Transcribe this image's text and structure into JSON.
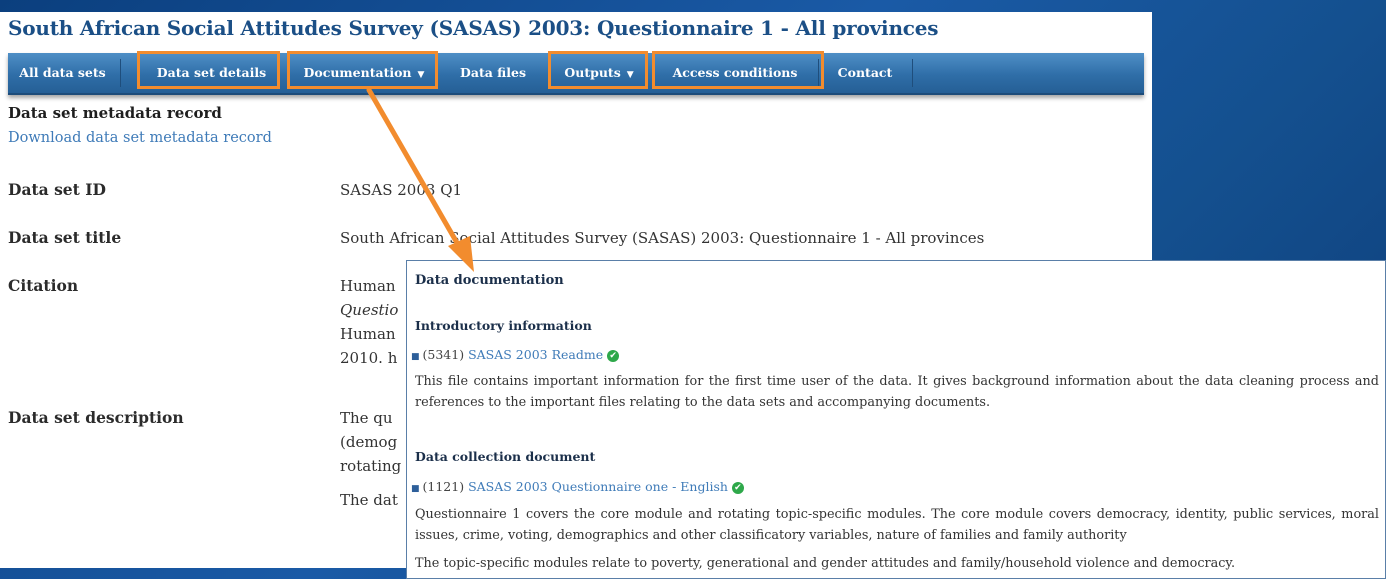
{
  "page_title": "South African Social Attitudes Survey (SASAS) 2003: Questionnaire 1 - All provinces",
  "nav": {
    "items": [
      {
        "label": "All data sets"
      },
      {
        "label": "Data set details"
      },
      {
        "label": "Documentation",
        "has_dropdown": true
      },
      {
        "label": "Data files"
      },
      {
        "label": "Outputs",
        "has_dropdown": true
      },
      {
        "label": "Access conditions"
      },
      {
        "label": "Contact"
      }
    ],
    "dropdown_caret": "▼",
    "highlighted": [
      "Data set details",
      "Documentation",
      "Outputs",
      "Access conditions"
    ]
  },
  "metadata": {
    "heading": "Data set metadata record",
    "download_link": "Download data set metadata record"
  },
  "fields": [
    {
      "label": "Data set ID",
      "value_lines": [
        "SASAS 2003 Q1"
      ]
    },
    {
      "label": "Data set title",
      "value_lines": [
        "South African Social Attitudes Survey (SASAS) 2003: Questionnaire 1 - All provinces"
      ]
    },
    {
      "label": "Citation",
      "value_lines": [
        "Human",
        "Questio",
        "Human",
        "2010. h"
      ]
    },
    {
      "label": "Data set description",
      "value_lines": [
        "The qu",
        "(demog",
        "rotating",
        "The dat"
      ]
    }
  ],
  "popup": {
    "title": "Data documentation",
    "sections": [
      {
        "heading": "Introductory information",
        "doc_id": "(5341)",
        "doc_title": "SASAS 2003 Readme",
        "description": "This file contains important information for the first time user of the data. It gives background information about the data cleaning process and references to the important files relating to the data sets and accompanying documents."
      },
      {
        "heading": "Data collection document",
        "doc_id": "(1121)",
        "doc_title": "SASAS 2003 Questionnaire one - English",
        "description": "Questionnaire 1 covers the core module and rotating topic-specific modules. The core module covers democracy, identity, public services, moral issues, crime, voting, demographics and other classificatory variables, nature of families and family authority",
        "description_2": "The topic-specific modules relate to poverty, generational and gender attitudes and family/household violence and democracy."
      }
    ],
    "check_icon": "✔"
  },
  "colors": {
    "background": "#1a5aa6",
    "title": "#1b4f86",
    "nav_bar": "#2f6ea8",
    "highlight_box": "#f28c2e",
    "link": "#3f7bb8",
    "check": "#2ea84a"
  }
}
